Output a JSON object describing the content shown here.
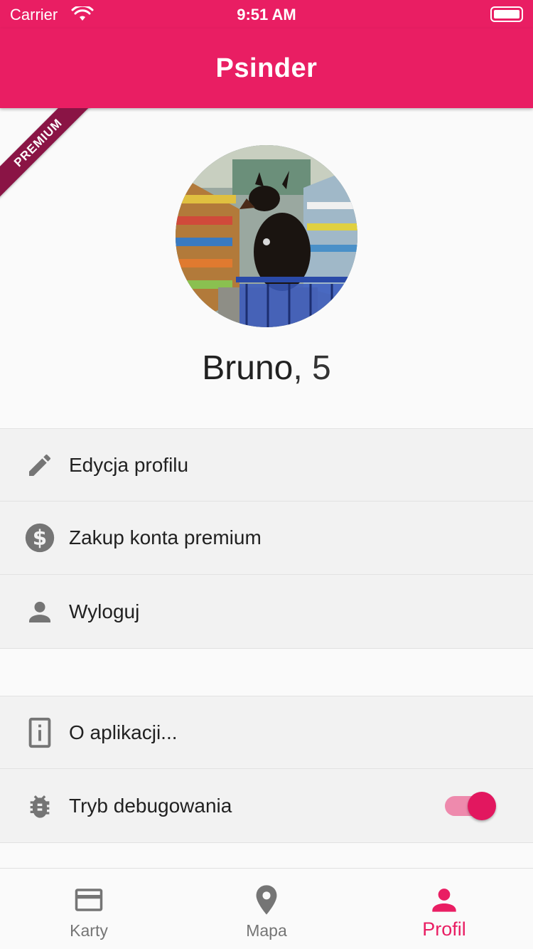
{
  "status_bar": {
    "carrier": "Carrier",
    "time": "9:51 AM"
  },
  "app_bar": {
    "title": "Psinder"
  },
  "ribbon": {
    "text": "PREMIUM"
  },
  "profile": {
    "name": "Bruno",
    "separator": ",",
    "age": "5"
  },
  "menu_group_1": [
    {
      "label": "Edycja profilu",
      "icon": "pencil-icon"
    },
    {
      "label": "Zakup konta premium",
      "icon": "dollar-circle-icon"
    },
    {
      "label": "Wyloguj",
      "icon": "person-icon"
    }
  ],
  "menu_group_2": [
    {
      "label": "O aplikacji...",
      "icon": "info-device-icon"
    },
    {
      "label": "Tryb debugowania",
      "icon": "bug-icon",
      "toggle_on": true
    }
  ],
  "bottom_nav": [
    {
      "label": "Karty",
      "icon": "card-icon",
      "active": false
    },
    {
      "label": "Mapa",
      "icon": "map-pin-icon",
      "active": false
    },
    {
      "label": "Profil",
      "icon": "person-icon",
      "active": true
    }
  ],
  "colors": {
    "primary": "#e91e63",
    "ribbon": "#8a1445",
    "icon_grey": "#757575"
  }
}
